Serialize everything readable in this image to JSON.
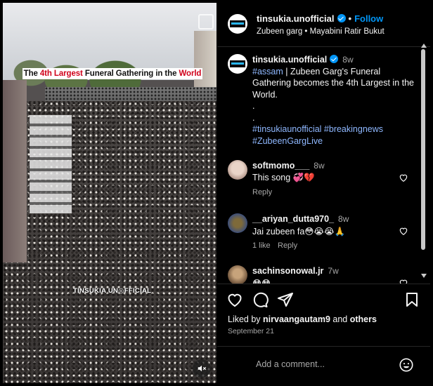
{
  "media": {
    "caption_parts": [
      "The ",
      "4th Largest",
      " Funeral Gathering in the ",
      "World"
    ],
    "watermark": "TINSUKIA UN◎FFICIAL"
  },
  "header": {
    "username": "tinsukia.unofficial",
    "follow_label": "Follow",
    "subtitle": "Zubeen garg • Mayabini Ratir Bukut"
  },
  "post": {
    "username": "tinsukia.unofficial",
    "time": "8w",
    "lines": [
      {
        "tag": "#assam",
        "text": " | Zubeen Garg's Funeral Gathering becomes the 4th Largest in the World."
      },
      {
        "text": "."
      },
      {
        "text": "."
      }
    ],
    "hashtags_line1": "#tinsukiaunofficial #breakingnews",
    "hashtags_line2": "#ZubeenGargLive"
  },
  "comments": [
    {
      "username": "softmomo___",
      "time": "8w",
      "text": "This song 💞💔",
      "meta": [
        "Reply"
      ]
    },
    {
      "username": "__ariyan_dutta970_",
      "time": "8w",
      "text": "Jai zubeen fa😳😭😭🙏",
      "meta": [
        "1 like",
        "Reply"
      ]
    },
    {
      "username": "sachinsonowal.jr",
      "time": "7w",
      "text": "😳😳",
      "meta": []
    }
  ],
  "footer": {
    "liked_by_prefix": "Liked by ",
    "liked_by_user": "nirvaangautam9",
    "liked_by_mid": " and ",
    "liked_by_others": "others",
    "date": "September 21",
    "add_comment_placeholder": "Add a comment..."
  },
  "colors": {
    "background": "#000000",
    "link_blue": "#0095f6",
    "hashtag": "#8fb8ff",
    "muted": "#a8a8a8",
    "caption_red": "#d0021b"
  }
}
